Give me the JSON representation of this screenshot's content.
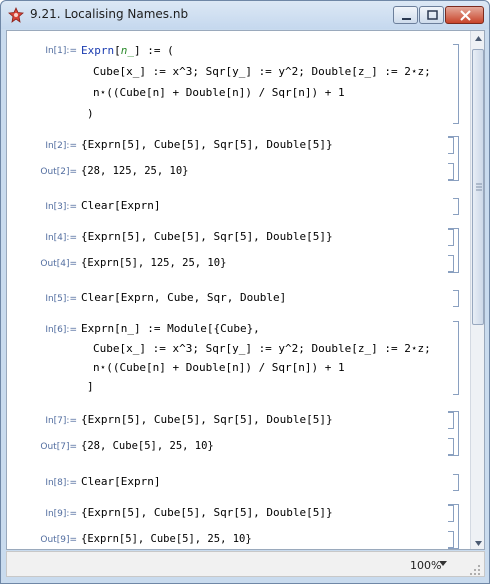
{
  "window": {
    "title": "9.21. Localising Names.nb"
  },
  "cells": {
    "in1_label": "In[1]:=",
    "in1_l1a": "Exprn",
    "in1_l1b": "[",
    "in1_l1c": "n_",
    "in1_l1d": "] := (",
    "in1_l2": "Cube[x_] := x^3; Sqr[y_] := y^2; Double[z_] := 2⋆z;",
    "in1_l3": "n⋆((Cube[n] + Double[n]) / Sqr[n]) + 1",
    "in1_l4": ")",
    "in2_label": "In[2]:=",
    "in2_code": "{Exprn[5], Cube[5], Sqr[5], Double[5]}",
    "out2_label": "Out[2]=",
    "out2_value": "{28, 125, 25, 10}",
    "in3_label": "In[3]:=",
    "in3_code": "Clear[Exprn]",
    "in4_label": "In[4]:=",
    "in4_code": "{Exprn[5], Cube[5], Sqr[5], Double[5]}",
    "out4_label": "Out[4]=",
    "out4_value": "{Exprn[5], 125, 25, 10}",
    "in5_label": "In[5]:=",
    "in5_code": "Clear[Exprn, Cube, Sqr, Double]",
    "in6_label": "In[6]:=",
    "in6_l1": "Exprn[n_] := Module[{Cube},",
    "in6_l2": "Cube[x_] := x^3; Sqr[y_] := y^2; Double[z_] := 2⋆z;",
    "in6_l3": "n⋆((Cube[n] + Double[n]) / Sqr[n]) + 1",
    "in6_l4": "]",
    "in7_label": "In[7]:=",
    "in7_code": "{Exprn[5], Cube[5], Sqr[5], Double[5]}",
    "out7_label": "Out[7]=",
    "out7_value": "{28, Cube[5], 25, 10}",
    "in8_label": "In[8]:=",
    "in8_code": "Clear[Exprn]",
    "in9_label": "In[9]:=",
    "in9_code": "{Exprn[5], Cube[5], Sqr[5], Double[5]}",
    "out9_label": "Out[9]=",
    "out9_value": "{Exprn[5], Cube[5], 25, 10}"
  },
  "status": {
    "zoom": "100%"
  },
  "colors": {
    "symbol": "#1a3bb0",
    "pattern": "#2a8a2a",
    "label": "#536ea0"
  }
}
